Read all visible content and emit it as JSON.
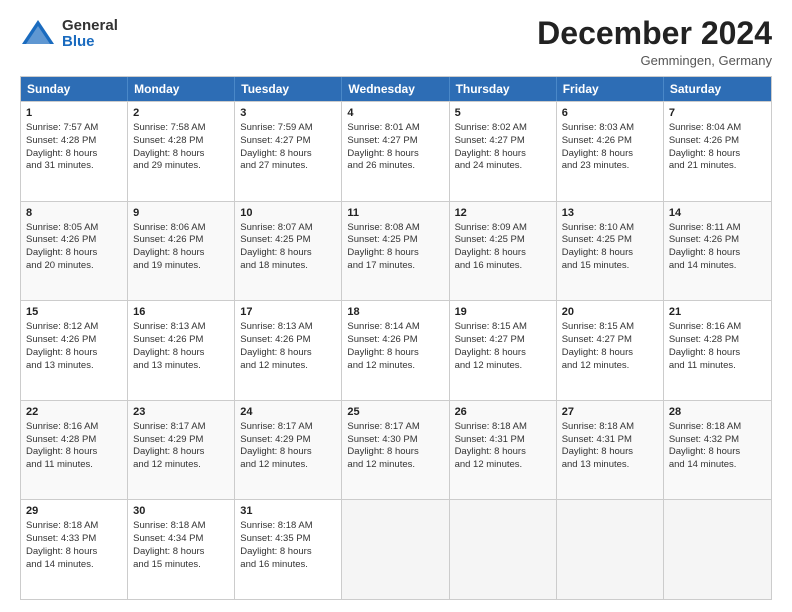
{
  "logo": {
    "general": "General",
    "blue": "Blue"
  },
  "header": {
    "month": "December 2024",
    "location": "Gemmingen, Germany"
  },
  "days": [
    "Sunday",
    "Monday",
    "Tuesday",
    "Wednesday",
    "Thursday",
    "Friday",
    "Saturday"
  ],
  "rows": [
    [
      {
        "day": "1",
        "lines": [
          "Sunrise: 7:57 AM",
          "Sunset: 4:28 PM",
          "Daylight: 8 hours",
          "and 31 minutes."
        ]
      },
      {
        "day": "2",
        "lines": [
          "Sunrise: 7:58 AM",
          "Sunset: 4:28 PM",
          "Daylight: 8 hours",
          "and 29 minutes."
        ]
      },
      {
        "day": "3",
        "lines": [
          "Sunrise: 7:59 AM",
          "Sunset: 4:27 PM",
          "Daylight: 8 hours",
          "and 27 minutes."
        ]
      },
      {
        "day": "4",
        "lines": [
          "Sunrise: 8:01 AM",
          "Sunset: 4:27 PM",
          "Daylight: 8 hours",
          "and 26 minutes."
        ]
      },
      {
        "day": "5",
        "lines": [
          "Sunrise: 8:02 AM",
          "Sunset: 4:27 PM",
          "Daylight: 8 hours",
          "and 24 minutes."
        ]
      },
      {
        "day": "6",
        "lines": [
          "Sunrise: 8:03 AM",
          "Sunset: 4:26 PM",
          "Daylight: 8 hours",
          "and 23 minutes."
        ]
      },
      {
        "day": "7",
        "lines": [
          "Sunrise: 8:04 AM",
          "Sunset: 4:26 PM",
          "Daylight: 8 hours",
          "and 21 minutes."
        ]
      }
    ],
    [
      {
        "day": "8",
        "lines": [
          "Sunrise: 8:05 AM",
          "Sunset: 4:26 PM",
          "Daylight: 8 hours",
          "and 20 minutes."
        ]
      },
      {
        "day": "9",
        "lines": [
          "Sunrise: 8:06 AM",
          "Sunset: 4:26 PM",
          "Daylight: 8 hours",
          "and 19 minutes."
        ]
      },
      {
        "day": "10",
        "lines": [
          "Sunrise: 8:07 AM",
          "Sunset: 4:25 PM",
          "Daylight: 8 hours",
          "and 18 minutes."
        ]
      },
      {
        "day": "11",
        "lines": [
          "Sunrise: 8:08 AM",
          "Sunset: 4:25 PM",
          "Daylight: 8 hours",
          "and 17 minutes."
        ]
      },
      {
        "day": "12",
        "lines": [
          "Sunrise: 8:09 AM",
          "Sunset: 4:25 PM",
          "Daylight: 8 hours",
          "and 16 minutes."
        ]
      },
      {
        "day": "13",
        "lines": [
          "Sunrise: 8:10 AM",
          "Sunset: 4:25 PM",
          "Daylight: 8 hours",
          "and 15 minutes."
        ]
      },
      {
        "day": "14",
        "lines": [
          "Sunrise: 8:11 AM",
          "Sunset: 4:26 PM",
          "Daylight: 8 hours",
          "and 14 minutes."
        ]
      }
    ],
    [
      {
        "day": "15",
        "lines": [
          "Sunrise: 8:12 AM",
          "Sunset: 4:26 PM",
          "Daylight: 8 hours",
          "and 13 minutes."
        ]
      },
      {
        "day": "16",
        "lines": [
          "Sunrise: 8:13 AM",
          "Sunset: 4:26 PM",
          "Daylight: 8 hours",
          "and 13 minutes."
        ]
      },
      {
        "day": "17",
        "lines": [
          "Sunrise: 8:13 AM",
          "Sunset: 4:26 PM",
          "Daylight: 8 hours",
          "and 12 minutes."
        ]
      },
      {
        "day": "18",
        "lines": [
          "Sunrise: 8:14 AM",
          "Sunset: 4:26 PM",
          "Daylight: 8 hours",
          "and 12 minutes."
        ]
      },
      {
        "day": "19",
        "lines": [
          "Sunrise: 8:15 AM",
          "Sunset: 4:27 PM",
          "Daylight: 8 hours",
          "and 12 minutes."
        ]
      },
      {
        "day": "20",
        "lines": [
          "Sunrise: 8:15 AM",
          "Sunset: 4:27 PM",
          "Daylight: 8 hours",
          "and 12 minutes."
        ]
      },
      {
        "day": "21",
        "lines": [
          "Sunrise: 8:16 AM",
          "Sunset: 4:28 PM",
          "Daylight: 8 hours",
          "and 11 minutes."
        ]
      }
    ],
    [
      {
        "day": "22",
        "lines": [
          "Sunrise: 8:16 AM",
          "Sunset: 4:28 PM",
          "Daylight: 8 hours",
          "and 11 minutes."
        ]
      },
      {
        "day": "23",
        "lines": [
          "Sunrise: 8:17 AM",
          "Sunset: 4:29 PM",
          "Daylight: 8 hours",
          "and 12 minutes."
        ]
      },
      {
        "day": "24",
        "lines": [
          "Sunrise: 8:17 AM",
          "Sunset: 4:29 PM",
          "Daylight: 8 hours",
          "and 12 minutes."
        ]
      },
      {
        "day": "25",
        "lines": [
          "Sunrise: 8:17 AM",
          "Sunset: 4:30 PM",
          "Daylight: 8 hours",
          "and 12 minutes."
        ]
      },
      {
        "day": "26",
        "lines": [
          "Sunrise: 8:18 AM",
          "Sunset: 4:31 PM",
          "Daylight: 8 hours",
          "and 12 minutes."
        ]
      },
      {
        "day": "27",
        "lines": [
          "Sunrise: 8:18 AM",
          "Sunset: 4:31 PM",
          "Daylight: 8 hours",
          "and 13 minutes."
        ]
      },
      {
        "day": "28",
        "lines": [
          "Sunrise: 8:18 AM",
          "Sunset: 4:32 PM",
          "Daylight: 8 hours",
          "and 14 minutes."
        ]
      }
    ],
    [
      {
        "day": "29",
        "lines": [
          "Sunrise: 8:18 AM",
          "Sunset: 4:33 PM",
          "Daylight: 8 hours",
          "and 14 minutes."
        ]
      },
      {
        "day": "30",
        "lines": [
          "Sunrise: 8:18 AM",
          "Sunset: 4:34 PM",
          "Daylight: 8 hours",
          "and 15 minutes."
        ]
      },
      {
        "day": "31",
        "lines": [
          "Sunrise: 8:18 AM",
          "Sunset: 4:35 PM",
          "Daylight: 8 hours",
          "and 16 minutes."
        ]
      },
      {
        "day": "",
        "lines": []
      },
      {
        "day": "",
        "lines": []
      },
      {
        "day": "",
        "lines": []
      },
      {
        "day": "",
        "lines": []
      }
    ]
  ]
}
